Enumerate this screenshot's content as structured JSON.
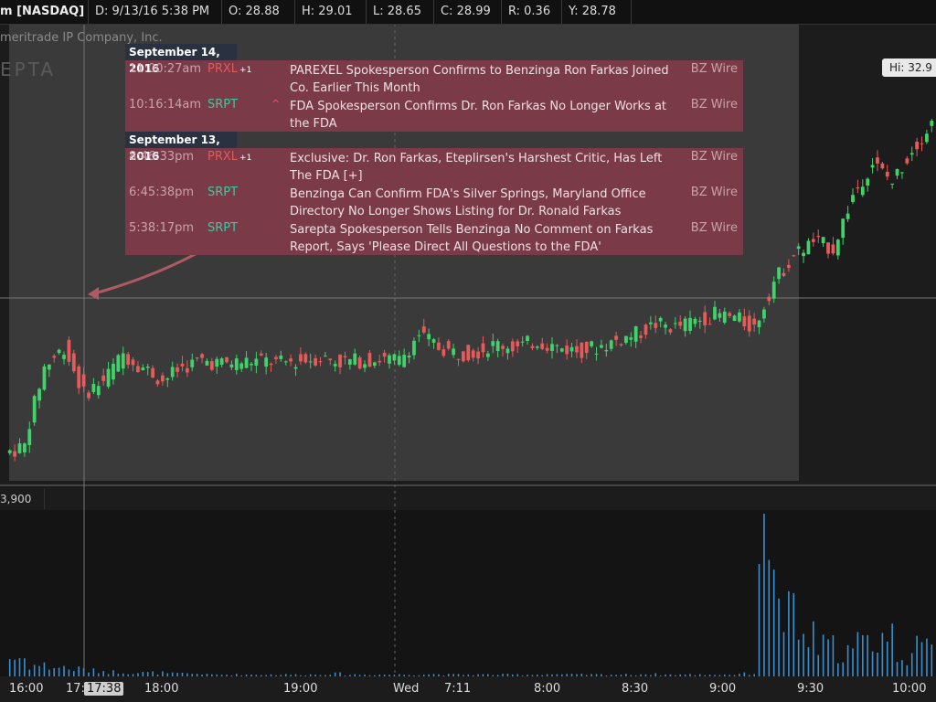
{
  "toolbar": {
    "symbol": "m [NASDAQ]",
    "date": "D:  9/13/16 5:38 PM",
    "open": "O:  28.88",
    "high": "H:  29.01",
    "low": "L:  28.65",
    "close": "C:  28.99",
    "range": "R:  0.36",
    "y": "Y:  28.78"
  },
  "watermark": {
    "company": "meritrade IP Company, Inc.",
    "ticker": "EPTA"
  },
  "hi_label": "Hi: 32.9",
  "volume_label": "3,900",
  "cursor_time": "17:38",
  "news": {
    "groups": [
      {
        "date": "September 14, 2016",
        "items": [
          {
            "time": "11:00:27am",
            "ticker": "PRXL",
            "suffix": "+1",
            "arrow": "",
            "headline": "PAREXEL Spokesperson Confirms to Benzinga Ron Farkas Joined Co. Earlier This Month",
            "source": "BZ Wire",
            "color": "red"
          },
          {
            "time": "10:16:14am",
            "ticker": "SRPT",
            "suffix": "",
            "arrow": "^",
            "headline": "FDA Spokesperson Confirms Dr. Ron Farkas No Longer Works at the FDA",
            "source": "BZ Wire",
            "color": "green"
          }
        ]
      },
      {
        "date": "September 13, 2016",
        "items": [
          {
            "time": "8:46:33pm",
            "ticker": "PRXL",
            "suffix": "+1",
            "arrow": "",
            "headline": "Exclusive: Dr. Ron Farkas, Eteplirsen's Harshest Critic, Has Left The FDA [+]",
            "source": "BZ Wire",
            "color": "red"
          },
          {
            "time": "6:45:38pm",
            "ticker": "SRPT",
            "suffix": "",
            "arrow": "",
            "headline": "Benzinga Can Confirm FDA's Silver Springs, Maryland Office Directory No Longer Shows Listing for Dr. Ronald Farkas",
            "source": "BZ Wire",
            "color": "green"
          },
          {
            "time": "5:38:17pm",
            "ticker": "SRPT",
            "suffix": "",
            "arrow": "",
            "headline": "Sarepta Spokesperson Tells Benzinga No Comment on Farkas Report, Says 'Please Direct All Questions to the FDA'",
            "source": "BZ Wire",
            "color": "green"
          }
        ]
      }
    ]
  },
  "colors": {
    "up": "#3fd46a",
    "down": "#e85a5a",
    "news_bg": "#7a3a48",
    "volume": "#3a8fd0"
  },
  "chart_data": {
    "type": "candlestick",
    "title": "",
    "x_ticks": [
      "16:00",
      "17:",
      "18:00",
      "19:00",
      "Wed",
      "7:11",
      "8:00",
      "8:30",
      "9:00",
      "9:30",
      "10:00"
    ],
    "y_reference": {
      "hi": 32.9,
      "crosshair_ohlc": {
        "open": 28.88,
        "high": 29.01,
        "low": 28.65,
        "close": 28.99
      }
    },
    "shaded_regions": [
      "after-hours 9/13",
      "pre-market 9/14"
    ],
    "price_path": [
      [
        27.4,
        27.5
      ],
      [
        27.6,
        28.7
      ],
      [
        28.7,
        29.0
      ],
      [
        29.0,
        28.3
      ],
      [
        28.3,
        28.5
      ],
      [
        28.5,
        28.9
      ],
      [
        28.9,
        28.7
      ],
      [
        28.7,
        28.5
      ],
      [
        28.5,
        28.7
      ],
      [
        28.7,
        28.8
      ],
      [
        28.8,
        28.75
      ],
      [
        28.75,
        28.78
      ],
      [
        28.78,
        28.8
      ],
      [
        28.8,
        28.76
      ],
      [
        28.76,
        28.8
      ],
      [
        28.8,
        28.85
      ],
      [
        28.85,
        28.78
      ],
      [
        28.78,
        28.8
      ],
      [
        28.8,
        28.82
      ],
      [
        28.82,
        28.8
      ],
      [
        28.8,
        29.2
      ],
      [
        29.2,
        29.0
      ],
      [
        29.0,
        28.9
      ],
      [
        28.9,
        28.95
      ],
      [
        28.95,
        29.05
      ],
      [
        29.05,
        29.0
      ],
      [
        29.0,
        29.1
      ],
      [
        29.1,
        29.0
      ],
      [
        29.0,
        28.95
      ],
      [
        28.95,
        29.0
      ],
      [
        29.0,
        29.1
      ],
      [
        29.1,
        29.2
      ],
      [
        29.2,
        29.35
      ],
      [
        29.35,
        29.3
      ],
      [
        29.3,
        29.4
      ],
      [
        29.4,
        29.5
      ],
      [
        29.5,
        29.45
      ],
      [
        29.45,
        29.3
      ],
      [
        29.3,
        30.0
      ],
      [
        30.0,
        30.4
      ],
      [
        30.4,
        30.6
      ],
      [
        30.6,
        30.5
      ],
      [
        30.5,
        31.3
      ],
      [
        31.3,
        31.8
      ],
      [
        31.8,
        31.5
      ],
      [
        31.5,
        32.0
      ],
      [
        32.0,
        32.4
      ]
    ],
    "volume": [
      1,
      0.6,
      0.5,
      0.4,
      0.3,
      0.25,
      0.2,
      0.2,
      0.15,
      0.15,
      0.1,
      0.1,
      0.1,
      0.1,
      0.1,
      0.1,
      0.15,
      0.1,
      0.1,
      0.1,
      0.1,
      0.12,
      0.1,
      0.1,
      0.1,
      0.1,
      0.1,
      0.12,
      0.1,
      0.1,
      0.1,
      0.1,
      0.12,
      0.1,
      0.1,
      0.1,
      0.1,
      0.15,
      8.5,
      3.2,
      2.1,
      1.6,
      1.4,
      1.8,
      2.2,
      1.2,
      1.5
    ]
  }
}
